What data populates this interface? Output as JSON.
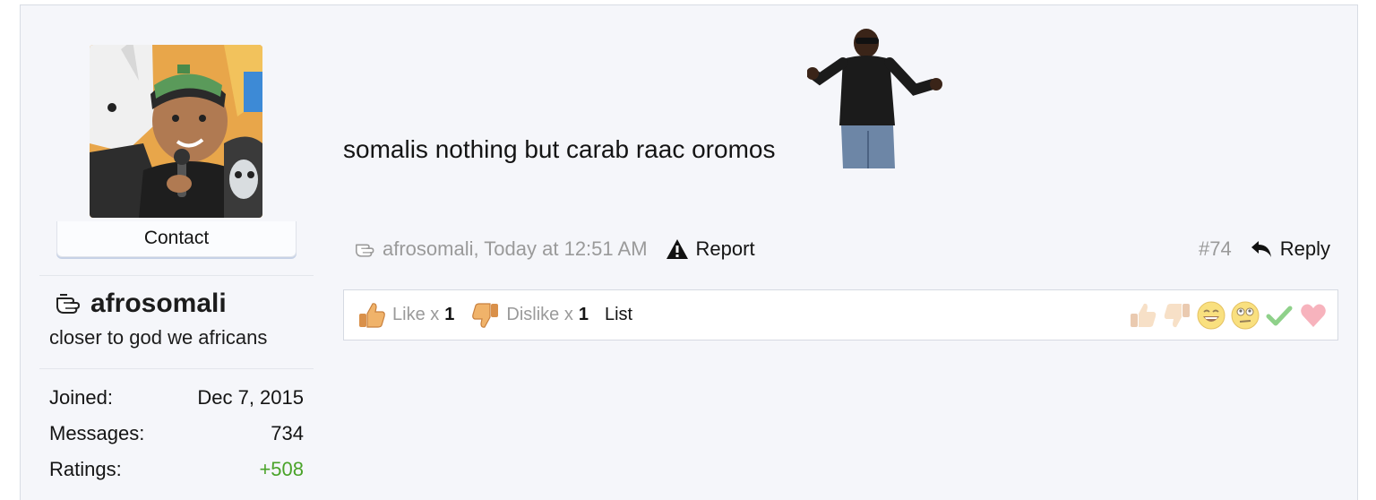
{
  "user": {
    "contact_label": "Contact",
    "username": "afrosomali",
    "user_title": "closer to god we africans",
    "stats": [
      {
        "label": "Joined:",
        "value": "Dec 7, 2015"
      },
      {
        "label": "Messages:",
        "value": "734"
      },
      {
        "label": "Ratings:",
        "value": "+508"
      }
    ]
  },
  "message": {
    "text": "somalis nothing but carab raac oromos"
  },
  "meta": {
    "author_time": "afrosomali, Today at 12:51 AM",
    "report_label": "Report",
    "post_number": "#74",
    "reply_label": "Reply"
  },
  "ratings": {
    "like_label": "Like x",
    "like_count": "1",
    "dislike_label": "Dislike x",
    "dislike_count": "1",
    "list_label": "List",
    "icons": [
      "like-icon",
      "dislike-icon",
      "funny-icon",
      "dumb-icon",
      "agree-icon",
      "love-icon"
    ]
  },
  "colors": {
    "accent_green": "#4aa329",
    "muted_text": "#9a9a9a",
    "panel_bg": "#f5f6fa"
  }
}
